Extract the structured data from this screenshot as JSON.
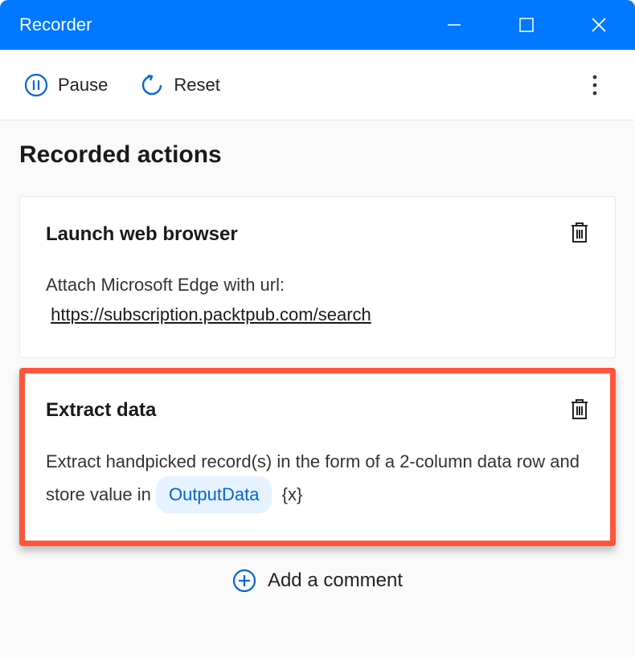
{
  "titlebar": {
    "title": "Recorder"
  },
  "toolbar": {
    "pause_label": "Pause",
    "reset_label": "Reset"
  },
  "section": {
    "title": "Recorded actions"
  },
  "actions": [
    {
      "title": "Launch web browser",
      "desc_prefix": "Attach Microsoft Edge with url:",
      "url": "https://subscription.packtpub.com/search"
    },
    {
      "title": "Extract data",
      "desc_prefix": "Extract handpicked record(s) in the form of a 2-column data row and store value in ",
      "variable": "OutputData",
      "brace": "{x}"
    }
  ],
  "add_comment": {
    "label": "Add a comment"
  }
}
